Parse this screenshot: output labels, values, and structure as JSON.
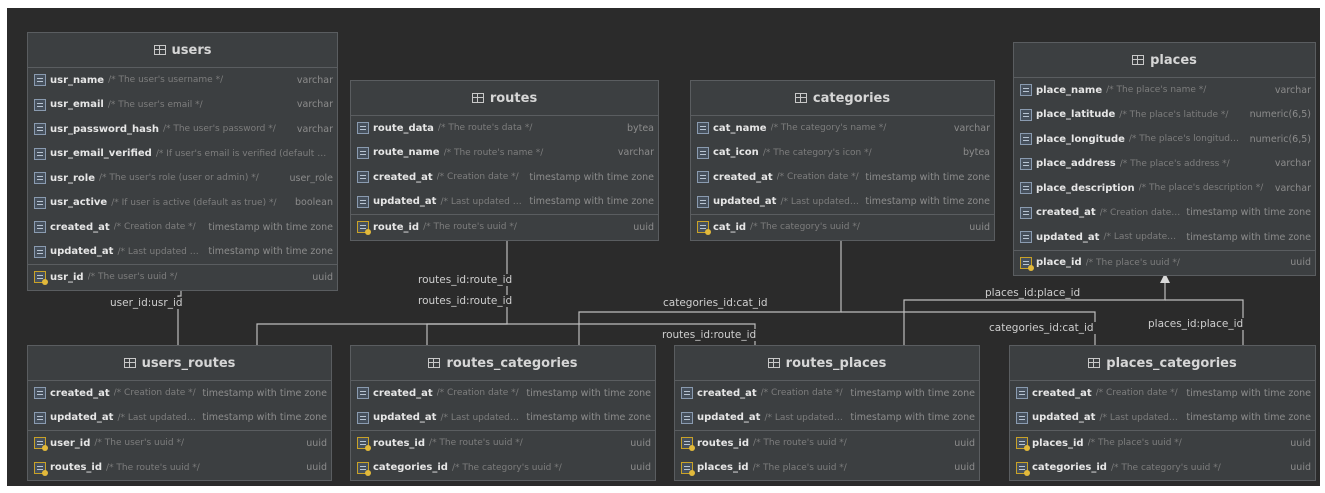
{
  "tables": {
    "users": {
      "name": "users",
      "columns": [
        {
          "name": "usr_name",
          "comment": "/* The user's username */",
          "type": "varchar"
        },
        {
          "name": "usr_email",
          "comment": "/* The user's email */",
          "type": "varchar"
        },
        {
          "name": "usr_password_hash",
          "comment": "/* The user's password */",
          "type": "varchar"
        },
        {
          "name": "usr_email_verified",
          "comment": "/* If user's email is verified (default as false) */",
          "type": ""
        },
        {
          "name": "usr_role",
          "comment": "/* The user's role (user or admin) */",
          "type": "user_role"
        },
        {
          "name": "usr_active",
          "comment": "/* If user is active (default as true) */",
          "type": "boolean"
        },
        {
          "name": "created_at",
          "comment": "/* Creation date */",
          "type": "timestamp with time zone"
        },
        {
          "name": "updated_at",
          "comment": "/* Last updated date */",
          "type": "timestamp with time zone"
        }
      ],
      "keys": [
        {
          "name": "usr_id",
          "comment": "/* The user's uuid */",
          "type": "uuid"
        }
      ]
    },
    "routes": {
      "name": "routes",
      "columns": [
        {
          "name": "route_data",
          "comment": "/* The route's data */",
          "type": "bytea"
        },
        {
          "name": "route_name",
          "comment": "/* The route's name */",
          "type": "varchar"
        },
        {
          "name": "created_at",
          "comment": "/* Creation date */",
          "type": "timestamp with time zone"
        },
        {
          "name": "updated_at",
          "comment": "/* Last updated date */",
          "type": "timestamp with time zone"
        }
      ],
      "keys": [
        {
          "name": "route_id",
          "comment": "/* The route's uuid */",
          "type": "uuid"
        }
      ]
    },
    "categories": {
      "name": "categories",
      "columns": [
        {
          "name": "cat_name",
          "comment": "/* The category's name */",
          "type": "varchar"
        },
        {
          "name": "cat_icon",
          "comment": "/* The category's icon */",
          "type": "bytea"
        },
        {
          "name": "created_at",
          "comment": "/* Creation date */",
          "type": "timestamp with time zone"
        },
        {
          "name": "updated_at",
          "comment": "/* Last updated date */",
          "type": "timestamp with time zone"
        }
      ],
      "keys": [
        {
          "name": "cat_id",
          "comment": "/* The category's uuid */",
          "type": "uuid"
        }
      ]
    },
    "places": {
      "name": "places",
      "columns": [
        {
          "name": "place_name",
          "comment": "/* The place's name */",
          "type": "varchar"
        },
        {
          "name": "place_latitude",
          "comment": "/* The place's latitude */",
          "type": "numeric(6,5)"
        },
        {
          "name": "place_longitude",
          "comment": "/* The place's longitude */",
          "type": "numeric(6,5)"
        },
        {
          "name": "place_address",
          "comment": "/* The place's address */",
          "type": "varchar"
        },
        {
          "name": "place_description",
          "comment": "/* The place's description */",
          "type": "varchar"
        },
        {
          "name": "created_at",
          "comment": "/* Creation date */",
          "type": "timestamp with time zone"
        },
        {
          "name": "updated_at",
          "comment": "/* Last updated date */",
          "type": "timestamp with time zone"
        }
      ],
      "keys": [
        {
          "name": "place_id",
          "comment": "/* The place's uuid */",
          "type": "uuid"
        }
      ]
    },
    "users_routes": {
      "name": "users_routes",
      "columns": [
        {
          "name": "created_at",
          "comment": "/* Creation date */",
          "type": "timestamp with time zone"
        },
        {
          "name": "updated_at",
          "comment": "/* Last updated date */",
          "type": "timestamp with time zone"
        }
      ],
      "keys": [
        {
          "name": "user_id",
          "comment": "/* The user's uuid */",
          "type": "uuid"
        },
        {
          "name": "routes_id",
          "comment": "/* The route's uuid */",
          "type": "uuid"
        }
      ]
    },
    "routes_categories": {
      "name": "routes_categories",
      "columns": [
        {
          "name": "created_at",
          "comment": "/* Creation date */",
          "type": "timestamp with time zone"
        },
        {
          "name": "updated_at",
          "comment": "/* Last updated date */",
          "type": "timestamp with time zone"
        }
      ],
      "keys": [
        {
          "name": "routes_id",
          "comment": "/* The route's uuid */",
          "type": "uuid"
        },
        {
          "name": "categories_id",
          "comment": "/* The category's uuid */",
          "type": "uuid"
        }
      ]
    },
    "routes_places": {
      "name": "routes_places",
      "columns": [
        {
          "name": "created_at",
          "comment": "/* Creation date */",
          "type": "timestamp with time zone"
        },
        {
          "name": "updated_at",
          "comment": "/* Last updated date */",
          "type": "timestamp with time zone"
        }
      ],
      "keys": [
        {
          "name": "routes_id",
          "comment": "/* The route's uuid */",
          "type": "uuid"
        },
        {
          "name": "places_id",
          "comment": "/* The place's uuid */",
          "type": "uuid"
        }
      ]
    },
    "places_categories": {
      "name": "places_categories",
      "columns": [
        {
          "name": "created_at",
          "comment": "/* Creation date */",
          "type": "timestamp with time zone"
        },
        {
          "name": "updated_at",
          "comment": "/* Last updated date */",
          "type": "timestamp with time zone"
        }
      ],
      "keys": [
        {
          "name": "places_id",
          "comment": "/* The place's uuid */",
          "type": "uuid"
        },
        {
          "name": "categories_id",
          "comment": "/* The category's uuid */",
          "type": "uuid"
        }
      ]
    }
  },
  "relations": [
    {
      "label": "user_id:usr_id"
    },
    {
      "label": "routes_id:route_id"
    },
    {
      "label": "routes_id:route_id"
    },
    {
      "label": "categories_id:cat_id"
    },
    {
      "label": "routes_id:route_id"
    },
    {
      "label": "places_id:place_id"
    },
    {
      "label": "categories_id:cat_id"
    },
    {
      "label": "places_id:place_id"
    }
  ],
  "colors": {
    "background": "#2b2b2b",
    "table": "#3c3f41",
    "border": "#5a5d60",
    "line": "#bdbdbd",
    "key_icon": "#e2b93b"
  }
}
